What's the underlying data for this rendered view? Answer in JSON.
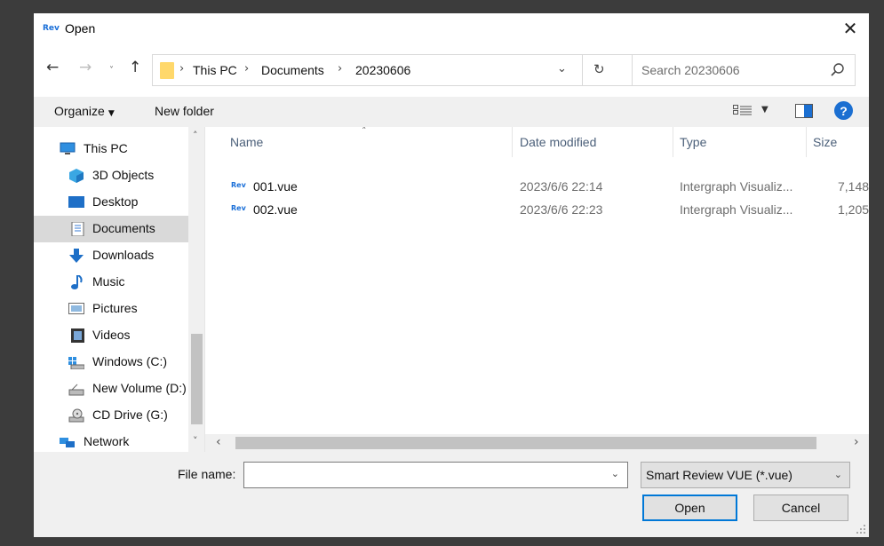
{
  "window": {
    "app_icon_text": "Rev",
    "title": "Open",
    "close_glyph": "✕"
  },
  "nav": {
    "back_glyph": "←",
    "forward_glyph": "→",
    "recent_glyph": "˅",
    "up_glyph": "↑",
    "breadcrumb": [
      "This PC",
      "Documents",
      "20230606"
    ],
    "crumb_separator": "›",
    "address_dropdown_glyph": "⌄",
    "refresh_glyph": "↻",
    "search_placeholder": "Search 20230606",
    "search_value": ""
  },
  "toolbar": {
    "organize_label": "Organize",
    "organize_dd_glyph": "▼",
    "new_folder_label": "New folder",
    "views_dd_glyph": "▼",
    "help_label": "?"
  },
  "nav_pane": {
    "items": [
      {
        "label": "This PC",
        "icon": "monitor-icon"
      },
      {
        "label": "3D Objects",
        "icon": "cube-3d-icon"
      },
      {
        "label": "Desktop",
        "icon": "desktop-icon"
      },
      {
        "label": "Documents",
        "icon": "document-icon",
        "selected": true
      },
      {
        "label": "Downloads",
        "icon": "download-arrow-icon"
      },
      {
        "label": "Music",
        "icon": "music-note-icon"
      },
      {
        "label": "Pictures",
        "icon": "picture-icon"
      },
      {
        "label": "Videos",
        "icon": "film-icon"
      },
      {
        "label": "Windows (C:)",
        "icon": "system-drive-icon"
      },
      {
        "label": "New Volume (D:)",
        "icon": "drive-icon"
      },
      {
        "label": "CD Drive (G:)",
        "icon": "cd-drive-icon"
      },
      {
        "label": "Network",
        "icon": "network-icon"
      }
    ],
    "scroll_up_glyph": "˄",
    "scroll_down_glyph": "˅"
  },
  "file_list": {
    "sort_glyph": "˄",
    "columns": [
      "Name",
      "Date modified",
      "Type",
      "Size"
    ],
    "rows": [
      {
        "icon_text": "Rev",
        "name": "001.vue",
        "date": "2023/6/6 22:14",
        "type": "Intergraph Visualiz...",
        "size": "7,148"
      },
      {
        "icon_text": "Rev",
        "name": "002.vue",
        "date": "2023/6/6 22:23",
        "type": "Intergraph Visualiz...",
        "size": "1,205"
      }
    ],
    "hscroll_left_glyph": "‹",
    "hscroll_right_glyph": "›"
  },
  "bottom": {
    "filename_label": "File name:",
    "filename_value": "",
    "filename_dd_glyph": "⌄",
    "filetype_value": "Smart Review VUE (*.vue)",
    "filetype_dd_glyph": "⌄",
    "open_label": "Open",
    "cancel_label": "Cancel"
  }
}
